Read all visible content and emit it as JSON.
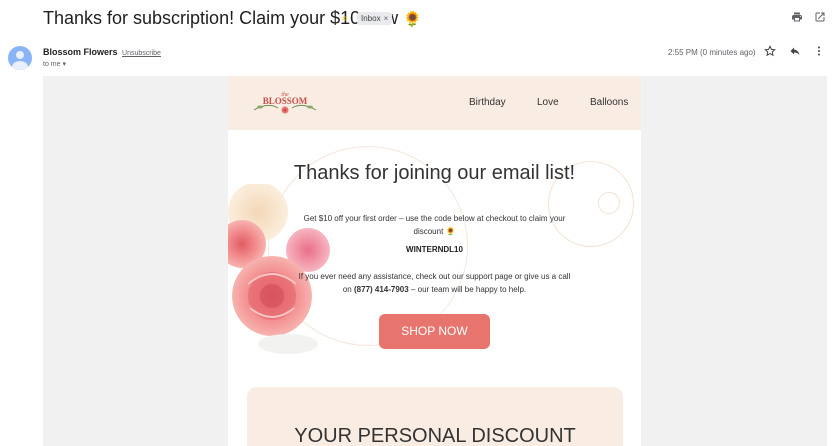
{
  "subject": {
    "title": "Thanks for subscription! Claim your $10 now",
    "emoji": "🌻",
    "importance_marker": "»",
    "label": "Inbox",
    "label_close": "×"
  },
  "sender": {
    "name": "Blossom Flowers",
    "unsubscribe": "Unsubscribe",
    "to": "to me ▾",
    "time": "2:55 PM (0 minutes ago)"
  },
  "icons": {
    "print": "print-icon",
    "open_new": "open-in-new-window-icon",
    "star": "star-icon",
    "reply": "reply-icon",
    "more": "more-vertical-icon"
  },
  "email": {
    "logo": {
      "the": "the",
      "name": "BLOSSOM"
    },
    "nav": [
      "Birthday",
      "Love",
      "Balloons"
    ],
    "title": "Thanks for joining our email list!",
    "para1": "Get $10 off your first order – use the code below at checkout to claim your discount",
    "para1_emoji": "🌻",
    "code": "WINTERNDL10",
    "para2_before": "If you ever need any assistance, check out our support page or give us a call on",
    "phone": "(877) 414-7903",
    "para2_after": "– our team will be happy to help.",
    "cta": "SHOP NOW",
    "discount_title": "YOUR PERSONAL DISCOUNT"
  },
  "colors": {
    "accent": "#e8756d",
    "nav_bg": "#f9ece3",
    "page_bg": "#f1f1f1"
  }
}
